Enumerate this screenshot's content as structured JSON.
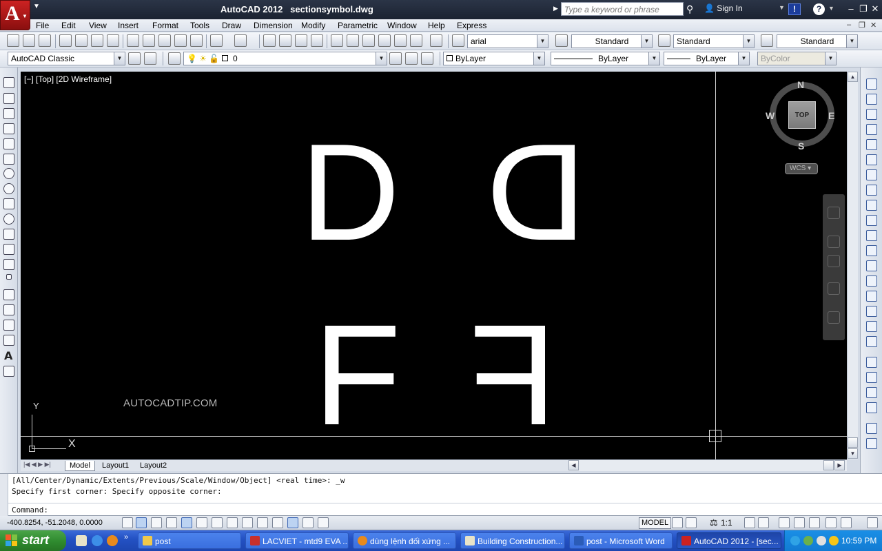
{
  "titlebar": {
    "app_name": "AutoCAD 2012",
    "document": "sectionsymbol.dwg",
    "search_placeholder": "Type a keyword or phrase",
    "signin": "Sign In",
    "info_label": "!",
    "help_label": "?"
  },
  "menu": [
    "File",
    "Edit",
    "View",
    "Insert",
    "Format",
    "Tools",
    "Draw",
    "Dimension",
    "Modify",
    "Parametric",
    "Window",
    "Help",
    "Express"
  ],
  "toolbar": {
    "text_style_font": "arial",
    "text_style": "Standard",
    "dim_style": "Standard",
    "table_style": "Standard",
    "workspace": "AutoCAD Classic",
    "layer": "0",
    "color": "ByLayer",
    "linetype": "ByLayer",
    "lineweight": "ByLayer",
    "plot_style": "ByColor"
  },
  "viewport": {
    "label": "[−] [Top] [2D Wireframe]",
    "letters": [
      "D",
      "D",
      "F",
      "F"
    ],
    "watermark": "AUTOCADTIP.COM",
    "ucs_x": "X",
    "ucs_y": "Y"
  },
  "viewcube": {
    "north": "N",
    "south": "S",
    "east": "E",
    "west": "W",
    "face": "TOP",
    "wcs": "WCS"
  },
  "layout_tabs": [
    "Model",
    "Layout1",
    "Layout2"
  ],
  "command": {
    "history": [
      "[All/Center/Dynamic/Extents/Previous/Scale/Window/Object] <real time>: _w",
      "Specify first corner: Specify opposite corner:"
    ],
    "prompt": "Command:"
  },
  "status": {
    "coordinates": "-400.8254, -51.2048, 0.0000",
    "model": "MODEL",
    "annotation_scale": "1:1"
  },
  "taskbar": {
    "start": "start",
    "tasks": [
      {
        "label": "post",
        "active": false
      },
      {
        "label": "LACVIET - mtd9 EVA ...",
        "active": false
      },
      {
        "label": "dùng lệnh đối xứng ...",
        "active": false
      },
      {
        "label": "Building Construction...",
        "active": false
      },
      {
        "label": "post - Microsoft Word",
        "active": false
      },
      {
        "label": "AutoCAD 2012 - [sec...",
        "active": true
      }
    ],
    "clock": "10:59 PM"
  }
}
